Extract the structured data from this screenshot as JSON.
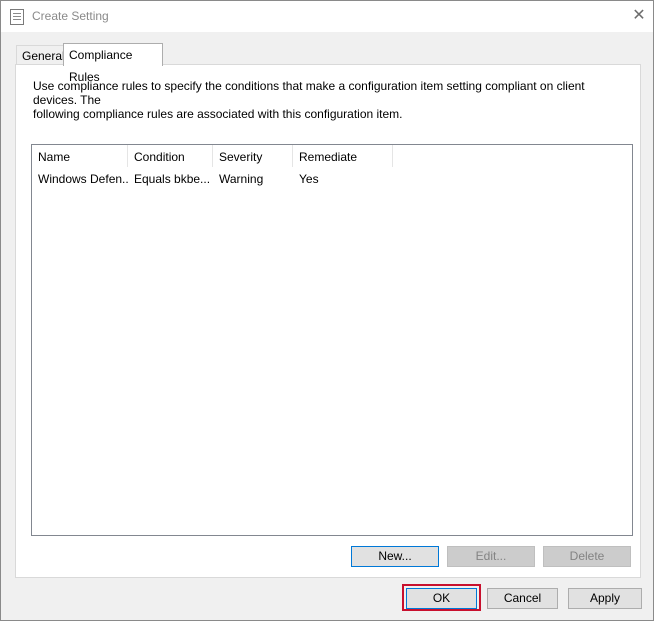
{
  "window": {
    "title": "Create Setting",
    "close_glyph": "✕"
  },
  "tabs": [
    {
      "label": "General",
      "selected": false
    },
    {
      "label": "Compliance Rules",
      "selected": true
    }
  ],
  "panel": {
    "description_line1": "Use compliance rules to specify the conditions that make a configuration item setting compliant on client devices. The",
    "description_line2": "following compliance rules are associated with this configuration item."
  },
  "rules_list": {
    "columns": [
      "Name",
      "Condition",
      "Severity",
      "Remediate"
    ],
    "rows": [
      {
        "name": "Windows Defen...",
        "condition": "Equals bkbe...",
        "severity": "Warning",
        "remediate": "Yes"
      }
    ]
  },
  "list_buttons": {
    "new": "New...",
    "edit": "Edit...",
    "delete": "Delete"
  },
  "dialog_buttons": {
    "ok": "OK",
    "cancel": "Cancel",
    "apply": "Apply"
  },
  "colors": {
    "highlight": "#c8102e",
    "focus_border": "#0078d7"
  },
  "icons": {
    "app": "settings-document-icon",
    "close": "close-icon"
  }
}
